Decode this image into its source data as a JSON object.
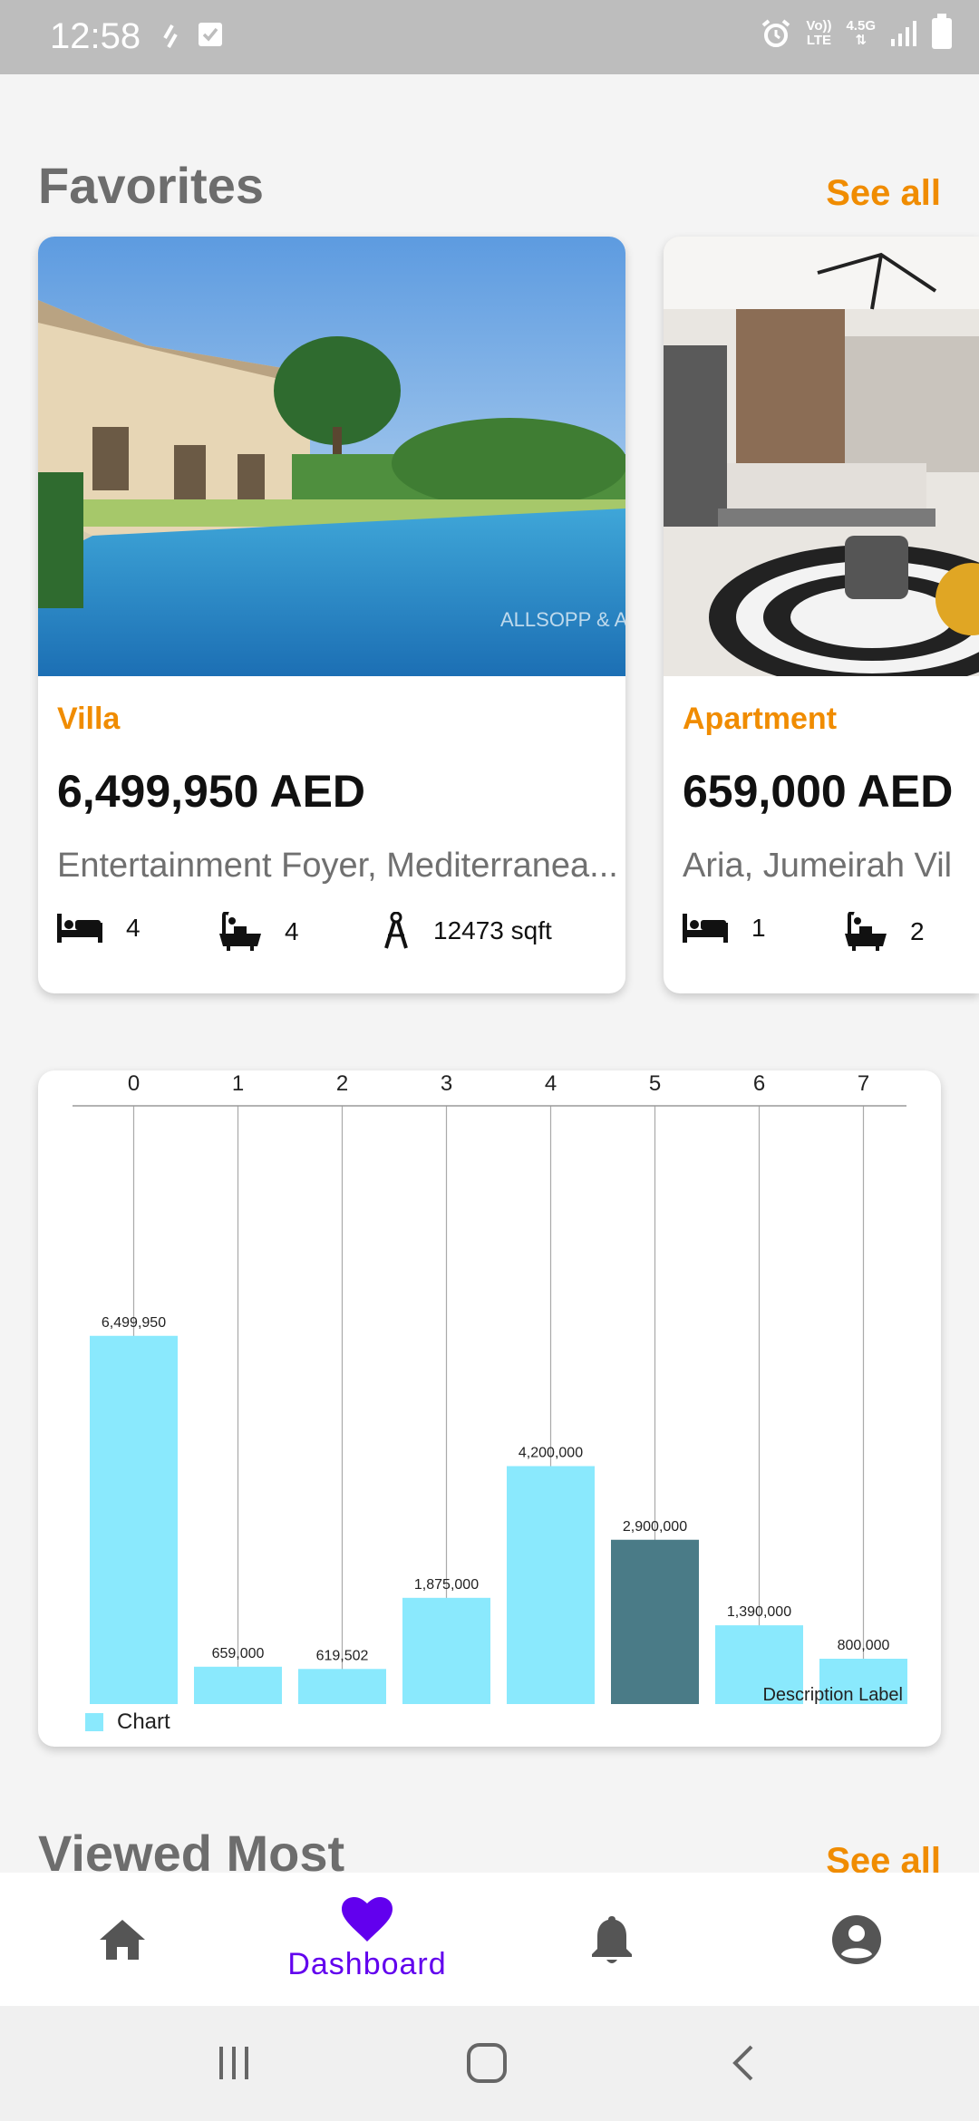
{
  "status_bar": {
    "time": "12:58",
    "volte_top": "Vo))",
    "volte_bottom": "LTE",
    "network": "4.5G",
    "icons": [
      "sync-icon",
      "check-square-icon",
      "alarm-icon",
      "volte-icon",
      "signal-icon",
      "battery-icon"
    ]
  },
  "favorites": {
    "title": "Favorites",
    "see_all": "See all",
    "cards": [
      {
        "type": "Villa",
        "price": "6,499,950 AED",
        "address": "Entertainment Foyer, Mediterranea...",
        "beds": "4",
        "baths": "4",
        "area": "12473 sqft",
        "image": "villa-pool-photo",
        "watermark": "ALLSOPP & ALLSOPP"
      },
      {
        "type": "Apartment",
        "price": "659,000 AED",
        "address": "Aria, Jumeirah Vil",
        "beds": "1",
        "baths": "2",
        "image": "apartment-interior-photo"
      }
    ]
  },
  "chart_data": {
    "type": "bar",
    "categories": [
      "0",
      "1",
      "2",
      "3",
      "4",
      "5",
      "6",
      "7"
    ],
    "values": [
      6499950,
      659000,
      619502,
      1875000,
      4200000,
      2900000,
      1390000,
      800000
    ],
    "value_labels": [
      "6,499,950",
      "659,000",
      "619,502",
      "1,875,000",
      "4,200,000",
      "2,900,000",
      "1,390,000",
      "800,000"
    ],
    "ylim": [
      0,
      7000000
    ],
    "grid": "vertical lines at categories",
    "x_axis": "top",
    "legend": {
      "label": "Chart",
      "placement": "bottom-left"
    },
    "description": "Description Label",
    "highlighted_index": 5,
    "bar_color": "#8ae9fd",
    "highlight_color": "#4a7b87"
  },
  "viewed_most": {
    "title": "Viewed Most",
    "see_all": "See all"
  },
  "bottom_nav": {
    "items": [
      {
        "icon": "home-icon",
        "label": ""
      },
      {
        "icon": "heart-icon",
        "label": "Dashboard",
        "active": true
      },
      {
        "icon": "bell-icon",
        "label": ""
      },
      {
        "icon": "account-icon",
        "label": ""
      }
    ]
  },
  "system_nav": [
    "recents-icon",
    "home-button-icon",
    "back-icon"
  ],
  "colors": {
    "accent": "#f08c00",
    "active_nav": "#6200ee",
    "title_gray": "#6d6d6d",
    "nav_icon": "#555555"
  }
}
